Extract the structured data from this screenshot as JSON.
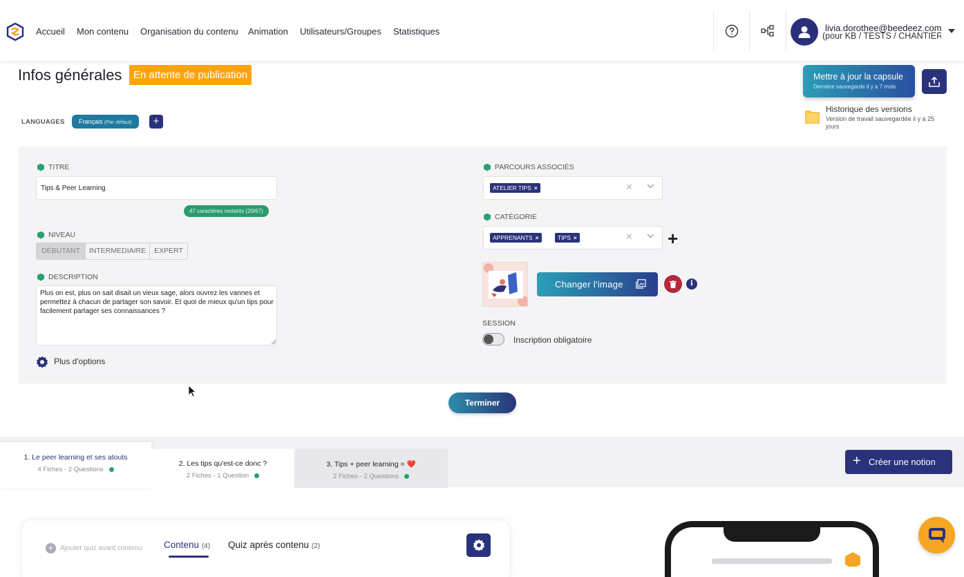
{
  "nav": {
    "items": [
      "Accueil",
      "Mon contenu",
      "Organisation du contenu",
      "Animation",
      "Utilisateurs/Groupes",
      "Statistiques"
    ],
    "user_email": "livia.dorothee@beedeez.com",
    "user_scope": "(pour KB / TESTS / CHANTIER"
  },
  "header": {
    "title": "Infos générales",
    "status_badge": "En attente de publication",
    "update_button": "Mettre à jour la capsule",
    "update_sub": "Dernière sauvegarde il y a 7 mois",
    "history_title": "Historique des versions",
    "history_sub": "Version de travail sauvegardée il y a 25 jours"
  },
  "languages": {
    "label": "LANGUAGES",
    "chip": "Français",
    "chip_default": "(Par défaut)",
    "add": "+"
  },
  "form": {
    "title_label": "TITRE",
    "title_value": "Tips & Peer Learning",
    "title_counter": "47 caractères restants (20/67)",
    "level_label": "NIVEAU",
    "levels": [
      "DÉBUTANT",
      "INTERMEDIAIRE",
      "EXPERT"
    ],
    "description_label": "DESCRIPTION",
    "description_value": "Plus on est, plus on sait disait un vieux sage, alors ouvrez les vannes et permettez à chacun de partager son savoir. Et quoi de mieux qu'un tips pour facilement partager ses connaissances ?",
    "more_options": "Plus d'options",
    "paths_label": "PARCOURS ASSOCIÉS",
    "paths_tags": [
      "ATELIER TIPS"
    ],
    "category_label": "CATÉGORIE",
    "category_tags": [
      "APPRENANTS",
      "TIPS"
    ],
    "change_image": "Changer l'image",
    "session_label": "SESSION",
    "session_toggle": "Inscription obligatoire",
    "finish": "Terminer"
  },
  "notions": [
    {
      "title": "1. Le peer learning et ses atouts",
      "sub": "4 Fiches - 2 Questions"
    },
    {
      "title": "2. Les tips qu'est-ce donc ?",
      "sub": "2 Fiches - 1 Question"
    },
    {
      "title": "3. Tips + peer learning = ❤️",
      "sub": "2 Fiches - 2 Questions"
    }
  ],
  "create_notion": "Créer une notion",
  "editor": {
    "add_quiz": "Ajouter quiz avant contenu",
    "tab_content": "Contenu",
    "tab_content_count": "(4)",
    "tab_quiz": "Quiz après contenu",
    "tab_quiz_count": "(2)"
  },
  "colors": {
    "primary": "#2a327c",
    "teal": "#2b9db5",
    "pending": "#ffa40c",
    "green": "#2aa070"
  }
}
